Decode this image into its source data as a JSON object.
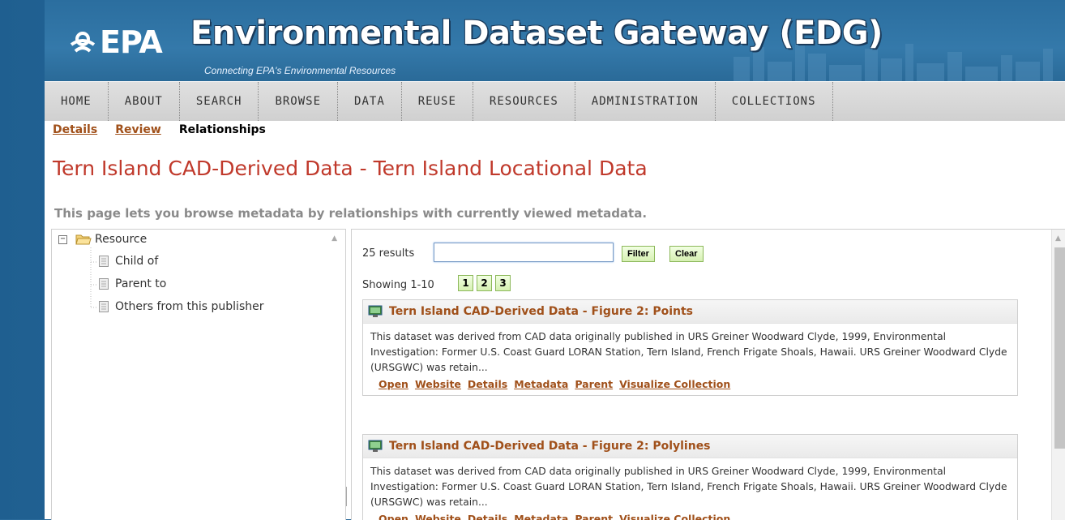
{
  "header": {
    "logo_text": "EPA",
    "title": "Environmental Dataset Gateway (EDG)",
    "tagline": "Connecting EPA's Environmental Resources"
  },
  "nav": {
    "items": [
      "HOME",
      "ABOUT",
      "SEARCH",
      "BROWSE",
      "DATA",
      "REUSE",
      "RESOURCES",
      "ADMINISTRATION",
      "COLLECTIONS"
    ]
  },
  "subtabs": {
    "items": [
      "Details",
      "Review",
      "Relationships"
    ],
    "active": "Relationships"
  },
  "page": {
    "title": "Tern Island CAD-Derived Data - Tern Island Locational Data",
    "description": "This page lets you browse metadata by relationships with currently viewed metadata."
  },
  "tree": {
    "root_toggle": "−",
    "root_label": "Resource",
    "children": [
      "Child of",
      "Parent to",
      "Others from this publisher"
    ]
  },
  "results": {
    "count_label": "25 results",
    "filter_value": "",
    "filter_button": "Filter",
    "clear_button": "Clear",
    "showing_label": "Showing 1-10",
    "pages": [
      "1",
      "2",
      "3"
    ],
    "items": [
      {
        "title": "Tern Island CAD-Derived Data - Figure 2: Points",
        "description": "This dataset was derived from CAD data originally published in URS Greiner Woodward Clyde, 1999, Environmental Investigation: Former U.S. Coast Guard LORAN Station, Tern Island, French Frigate Shoals, Hawaii. URS Greiner Woodward Clyde (URSGWC) was retain...",
        "links": [
          "Open",
          "Website",
          "Details",
          "Metadata",
          "Parent",
          "Visualize Collection"
        ]
      },
      {
        "title": "Tern Island CAD-Derived Data - Figure 2: Polylines",
        "description": "This dataset was derived from CAD data originally published in URS Greiner Woodward Clyde, 1999, Environmental Investigation: Former U.S. Coast Guard LORAN Station, Tern Island, French Frigate Shoals, Hawaii. URS Greiner Woodward Clyde (URSGWC) was retain...",
        "links": [
          "Open",
          "Website",
          "Details",
          "Metadata",
          "Parent",
          "Visualize Collection"
        ]
      }
    ]
  },
  "colors": {
    "banner_blue": "#2b6e9f",
    "link_brown": "#a0501a",
    "title_red": "#c0392b",
    "button_green": "#d6f0b2"
  }
}
